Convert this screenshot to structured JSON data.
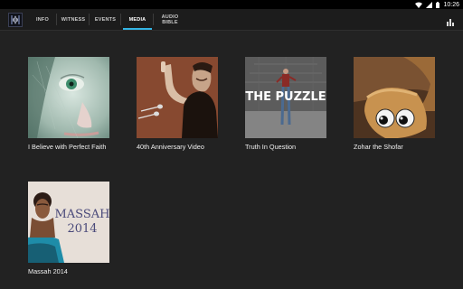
{
  "status_bar": {
    "time": "10:26"
  },
  "tabs": [
    {
      "label": "INFO"
    },
    {
      "label": "WITNESS"
    },
    {
      "label": "EVENTS"
    },
    {
      "label": "MEDIA",
      "active": true
    },
    {
      "label": "AUDIO\nBIBLE"
    }
  ],
  "colors": {
    "accent": "#33b5e5",
    "background": "#222222"
  },
  "media": [
    {
      "title": "I Believe with Perfect Faith"
    },
    {
      "title": "40th Anniversary Video"
    },
    {
      "title": "Truth In Question",
      "overlay": "THE PUZZLE"
    },
    {
      "title": "Zohar the Shofar"
    },
    {
      "title": "Massah 2014",
      "overlay_line1": "MASSAH",
      "overlay_line2": "2014"
    }
  ],
  "icons": {
    "status": [
      "wifi-icon",
      "signal-icon",
      "battery-icon"
    ],
    "toolbar": "bar-chart-icon"
  }
}
